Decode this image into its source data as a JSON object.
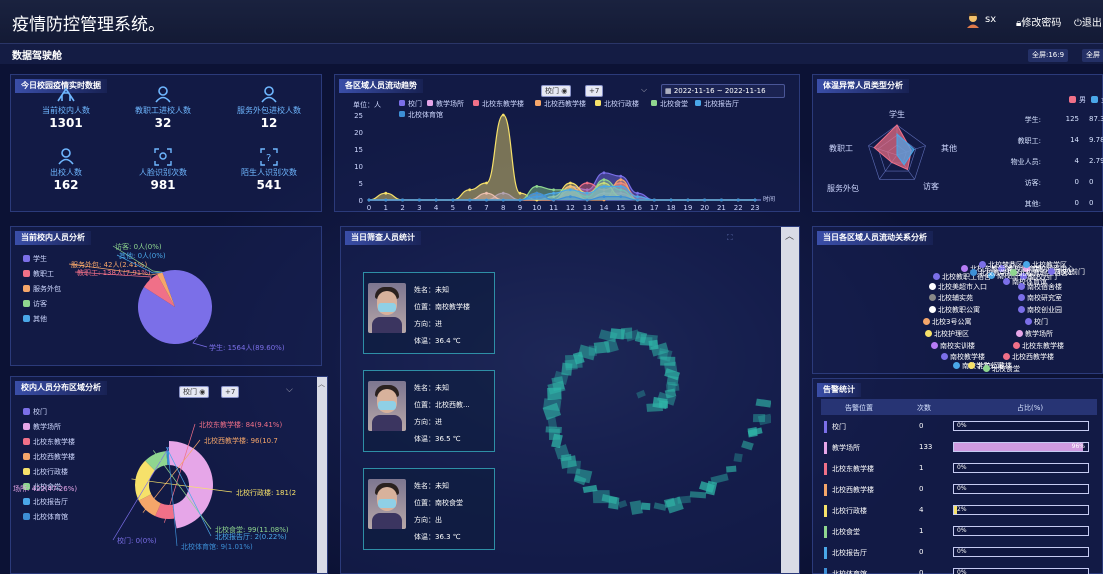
{
  "app": {
    "title": "疫情防控管理系统。",
    "dashboard": "数据驾驶舱",
    "user": "sx",
    "change_password": "修改密码",
    "logout": "退出",
    "fullscreen_buttons": [
      "全屏:16:9",
      "全屏"
    ]
  },
  "campus_now": {
    "title": "今日校园疫情实时数据",
    "stats": [
      {
        "label": "当前校内人数",
        "value": "1301",
        "icon": "building-icon"
      },
      {
        "label": "教职工进校人数",
        "value": "32",
        "icon": "person-icon"
      },
      {
        "label": "服务外包进校人数",
        "value": "12",
        "icon": "person-icon"
      },
      {
        "label": "出校人数",
        "value": "162",
        "icon": "person-icon"
      },
      {
        "label": "人脸识别次数",
        "value": "981",
        "icon": "face-scan-icon"
      },
      {
        "label": "陌生人识别次数",
        "value": "541",
        "icon": "stranger-scan-icon"
      }
    ]
  },
  "trend": {
    "title": "各区域人员流动趋势",
    "filter_selected": "校门",
    "filter_more": "+7",
    "date_range": "2022-11-16 ~ 2022-11-16",
    "x_axis_name": "时间",
    "colors": {
      "accent": "#7b6fe8"
    }
  },
  "chart_data": [
    {
      "type": "area",
      "ylabel": "单位：人",
      "xlabel": "时间",
      "x": [
        0,
        1,
        2,
        3,
        4,
        5,
        6,
        7,
        8,
        9,
        10,
        11,
        12,
        13,
        14,
        15,
        16,
        17,
        18,
        19,
        20,
        21,
        22,
        23
      ],
      "ylim": [
        0,
        25
      ],
      "yticks": [
        0,
        5,
        10,
        15,
        20,
        25
      ],
      "legend": "top",
      "series": [
        {
          "name": "校门",
          "color": "#7b6fe8",
          "values": [
            0,
            0,
            0,
            0,
            0,
            0,
            0,
            0,
            2,
            0,
            0,
            0,
            4,
            3,
            8,
            7,
            2,
            0,
            0,
            0,
            0,
            0,
            0,
            0
          ]
        },
        {
          "name": "教学场所",
          "color": "#e6a6e8",
          "values": [
            0,
            0,
            0,
            0,
            0,
            0,
            0,
            2,
            0,
            0,
            2,
            0,
            3,
            0,
            2,
            2,
            0,
            0,
            0,
            0,
            0,
            0,
            0,
            0
          ]
        },
        {
          "name": "北校东教学楼",
          "color": "#f07088",
          "values": [
            0,
            0,
            0,
            0,
            0,
            0,
            0,
            0,
            0,
            0,
            0,
            0,
            2,
            5,
            3,
            5,
            1,
            0,
            0,
            0,
            0,
            0,
            0,
            0
          ]
        },
        {
          "name": "北校西教学楼",
          "color": "#f5a66a",
          "values": [
            0,
            0,
            0,
            0,
            0,
            0,
            0,
            0,
            0,
            0,
            0,
            0,
            4,
            0,
            0,
            6,
            0,
            0,
            0,
            0,
            0,
            0,
            0,
            0
          ]
        },
        {
          "name": "北校行政楼",
          "color": "#f6e16a",
          "values": [
            0,
            2,
            0,
            0,
            0,
            0,
            3,
            5,
            25,
            2,
            0,
            1,
            5,
            2,
            5,
            1,
            0,
            0,
            0,
            0,
            0,
            0,
            0,
            0
          ]
        },
        {
          "name": "北校食堂",
          "color": "#8fd68f",
          "values": [
            0,
            0,
            0,
            0,
            0,
            0,
            0,
            0,
            0,
            0,
            4,
            3,
            3,
            1,
            6,
            3,
            0,
            0,
            0,
            0,
            0,
            0,
            0,
            0
          ]
        },
        {
          "name": "北校报告厅",
          "color": "#4aa7e8",
          "values": [
            0,
            0,
            0,
            0,
            0,
            0,
            0,
            0,
            0,
            0,
            1,
            2,
            3,
            2,
            4,
            4,
            1,
            0,
            0,
            0,
            0,
            0,
            0,
            0
          ]
        },
        {
          "name": "北校体育馆",
          "color": "#3d8fd6",
          "values": [
            0,
            0,
            0,
            0,
            0,
            0,
            0,
            0,
            0,
            0,
            2,
            0,
            1,
            0,
            1,
            1,
            0,
            0,
            0,
            0,
            0,
            0,
            0,
            0
          ]
        }
      ]
    },
    {
      "type": "pie",
      "title": "当前校内人员分析",
      "legend": "left",
      "slices": [
        {
          "name": "学生",
          "value": 1564,
          "label": "学生: 1564人(89.60%)",
          "color": "#7b6fe8"
        },
        {
          "name": "教职工",
          "value": 138,
          "label": "教职工: 138人(7.91%)",
          "color": "#f07088"
        },
        {
          "name": "服务外包",
          "value": 42,
          "label": "服务外包: 42人(2.41%)",
          "color": "#f5a66a"
        },
        {
          "name": "访客",
          "value": 0,
          "label": "访客: 0人(0%)",
          "color": "#8fd68f"
        },
        {
          "name": "其他",
          "value": 0,
          "label": "其他: 0人(0%)",
          "color": "#4aa7e8"
        }
      ]
    },
    {
      "type": "pie",
      "title": "校内人员分布区域分析",
      "legend": "left",
      "slices": [
        {
          "name": "校门",
          "value": 0,
          "label": "校门: 0(0%)",
          "color": "#7b6fe8"
        },
        {
          "name": "教学场所",
          "value": 422,
          "label": "场所: 422(47.26%)",
          "color": "#e6a6e8"
        },
        {
          "name": "北校东教学楼",
          "value": 84,
          "label": "北校东教学楼: 84(9.41%)",
          "color": "#f07088"
        },
        {
          "name": "北校西教学楼",
          "value": 96,
          "label": "北校西教学楼: 96(10.7",
          "color": "#f5a66a"
        },
        {
          "name": "北校行政楼",
          "value": 181,
          "label": "北校行政楼: 181(2",
          "color": "#f6e16a"
        },
        {
          "name": "北校食堂",
          "value": 99,
          "label": "北校食堂: 99(11.08%)",
          "color": "#8fd68f"
        },
        {
          "name": "北校报告厅",
          "value": 2,
          "label": "北校报告厅: 2(0.22%)",
          "color": "#4aa7e8"
        },
        {
          "name": "北校体育馆",
          "value": 9,
          "label": "北校体育馆: 9(1.01%)",
          "color": "#3d8fd6"
        }
      ]
    },
    {
      "type": "radar",
      "title": "体温异常人员类型分析",
      "indicators": [
        "学生",
        "其他",
        "访客",
        "服务外包",
        "教职工"
      ],
      "series": [
        {
          "name": "男",
          "color": "#f07088",
          "values": [
            1.0,
            0.5,
            0.6,
            0.3,
            0.8
          ]
        },
        {
          "name": "女",
          "color": "#4aa7e8",
          "values": [
            0.7,
            0.6,
            0.4,
            0.0,
            0.0
          ]
        }
      ]
    },
    {
      "type": "table",
      "title": "体温异常人员类型分析",
      "columns": [
        "类型",
        "人数",
        "占比"
      ],
      "rows": [
        [
          "学生:",
          "125",
          "87.38"
        ],
        [
          "教职工:",
          "14",
          "9.78"
        ],
        [
          "物业人员:",
          "4",
          "2.79"
        ],
        [
          "访客:",
          "0",
          "0"
        ],
        [
          "其他:",
          "0",
          "0"
        ]
      ]
    }
  ],
  "temp_table": {
    "rows": [
      {
        "label": "学生:",
        "count": "125",
        "ratio": "87.38"
      },
      {
        "label": "教职工:",
        "count": "14",
        "ratio": "9.78"
      },
      {
        "label": "物业人员:",
        "count": "4",
        "ratio": "2.79"
      },
      {
        "label": "访客:",
        "count": "0",
        "ratio": "0"
      },
      {
        "label": "其他:",
        "count": "0",
        "ratio": "0"
      }
    ],
    "legend_male": "男",
    "legend_female": "女"
  },
  "radar": {
    "labels": {
      "top": "学生",
      "right": "其他",
      "bottom_right": "访客",
      "bottom_left": "服务外包",
      "left": "教职工"
    }
  },
  "inspect": {
    "title": "当日筛查人员统计",
    "cards": [
      {
        "name": "姓名：未知",
        "location": "位置：南校教学楼",
        "direction": "方向：进",
        "temp": "体温：36.4 ℃"
      },
      {
        "name": "姓名：未知",
        "location": "位置：北校西教...",
        "direction": "方向：进",
        "temp": "体温：36.5 ℃"
      },
      {
        "name": "姓名：未知",
        "location": "位置：南校食堂",
        "direction": "方向：出",
        "temp": "体温：36.3 ℃"
      }
    ]
  },
  "relation": {
    "title": "当日各区域人员流动关系分析",
    "nodes": [
      {
        "label": "北校东教学院",
        "color": "#b57bf5",
        "tx": "b"
      },
      {
        "label": "南校体育场",
        "color": "#7b6fe8",
        "tx": "b"
      },
      {
        "label": "南校网络中心",
        "color": "#e6a6e8",
        "tx": "b"
      },
      {
        "label": "北校教职工宿舍",
        "color": "#7b6fe8",
        "tx": "b"
      },
      {
        "label": "南校图书馆",
        "color": "#4aa7e8",
        "tx": "b"
      },
      {
        "label": "南校西门",
        "color": "#7b6fe8",
        "tx": "b"
      },
      {
        "label": "北校教学楼区",
        "color": "#3d8fd6",
        "tx": "b"
      },
      {
        "label": "北校教职工宿舍1",
        "color": "#8fd68f",
        "tx": "b"
      },
      {
        "label": "北校前门",
        "color": "#7b6fe8",
        "tx": "b"
      },
      {
        "label": "北校梦鼎区",
        "color": "#7b6fe8",
        "tx": "b"
      },
      {
        "label": "北校教学区",
        "color": "#4aa7e8",
        "tx": "b"
      },
      {
        "label": "北校美超市入口",
        "color": "#ffffff",
        "tx": "w"
      },
      {
        "label": "南校体育馆",
        "color": "#7b6fe8",
        "tx": "b"
      },
      {
        "label": "南校宿舍楼",
        "color": "#7b6fe8",
        "tx": "b"
      },
      {
        "label": "北校辅实苑",
        "color": "#888888",
        "tx": "w"
      },
      {
        "label": "南校研究室",
        "color": "#7b6fe8",
        "tx": "b"
      },
      {
        "label": "北校教职公寓",
        "color": "#ffffff",
        "tx": "w"
      },
      {
        "label": "南校创业园",
        "color": "#7b6fe8",
        "tx": "b"
      },
      {
        "label": "北校3号公寓",
        "color": "#f5a66a",
        "tx": "w"
      },
      {
        "label": "校门",
        "color": "#7b6fe8",
        "tx": "b"
      },
      {
        "label": "北校护理区",
        "color": "#f6e16a",
        "tx": "w"
      },
      {
        "label": "教学场所",
        "color": "#e6a6e8",
        "tx": "b"
      },
      {
        "label": "南校实训楼",
        "color": "#b57bf5",
        "tx": "b"
      },
      {
        "label": "北校东教学楼",
        "color": "#f07088",
        "tx": "b"
      },
      {
        "label": "南校教学楼",
        "color": "#7b6fe8",
        "tx": "b"
      },
      {
        "label": "北校西教学楼",
        "color": "#f07088",
        "tx": "b"
      },
      {
        "label": "南校学生公寓",
        "color": "#4aa7e8",
        "tx": "b"
      },
      {
        "label": "北校行政楼",
        "color": "#f6e16a",
        "tx": "b"
      },
      {
        "label": "北校食堂",
        "color": "#8fd68f",
        "tx": "b"
      }
    ]
  },
  "alarm": {
    "title": "告警统计",
    "headers": [
      "告警位置",
      "次数",
      "占比(%)"
    ],
    "rows": [
      {
        "name": "校门",
        "count": "0",
        "pct": "0%",
        "pct_value": 0,
        "color": "#7b6fe8"
      },
      {
        "name": "教学场所",
        "count": "133",
        "pct": "96%",
        "pct_value": 96,
        "color": "#e6a6e8"
      },
      {
        "name": "北校东教学楼",
        "count": "1",
        "pct": "0%",
        "pct_value": 0,
        "color": "#f07088"
      },
      {
        "name": "北校西教学楼",
        "count": "0",
        "pct": "0%",
        "pct_value": 0,
        "color": "#f5a66a"
      },
      {
        "name": "北校行政楼",
        "count": "4",
        "pct": "2%",
        "pct_value": 2,
        "color": "#f6e16a"
      },
      {
        "name": "北校食堂",
        "count": "1",
        "pct": "0%",
        "pct_value": 0,
        "color": "#8fd68f"
      },
      {
        "name": "北校报告厅",
        "count": "0",
        "pct": "0%",
        "pct_value": 0,
        "color": "#4aa7e8"
      },
      {
        "name": "北校体育馆",
        "count": "0",
        "pct": "0%",
        "pct_value": 0,
        "color": "#3d8fd6"
      }
    ]
  },
  "area_filter": {
    "selected": "校门",
    "more": "+7"
  }
}
